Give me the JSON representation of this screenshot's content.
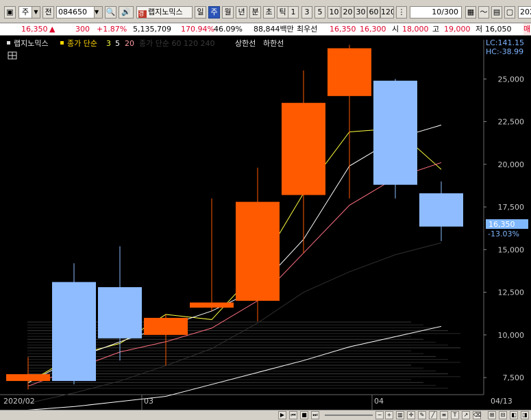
{
  "toolbar": {
    "market_select": "주",
    "prev_label": "전",
    "stock_code": "084650",
    "stock_name": "랩지노믹스",
    "period_tabs": [
      {
        "label": "일",
        "active": false
      },
      {
        "label": "주",
        "active": true
      },
      {
        "label": "월",
        "active": false
      },
      {
        "label": "년",
        "active": false
      },
      {
        "label": "분",
        "active": false
      },
      {
        "label": "초",
        "active": false
      },
      {
        "label": "틱",
        "active": false
      }
    ],
    "interval_buttons": [
      "1",
      "3",
      "5",
      "10",
      "20",
      "30",
      "60",
      "120"
    ],
    "count_value": "10",
    "count_total": "/300",
    "date_value": "202"
  },
  "quote": {
    "price": "16,350",
    "change_symbol": "▲",
    "change": "300",
    "change_pct": "+1.87%",
    "volume": "5,135,709",
    "volume_ratio": "170.94%",
    "turnover": "46.09%",
    "amount": "88,844백만",
    "ref_label": "최우선",
    "best_ask": "16,350",
    "best_bid": "16,300",
    "open_label": "시",
    "open": "18,000",
    "high_label": "고",
    "high": "19,000",
    "low_label": "저",
    "low": "16,050",
    "trailing": "매"
  },
  "legend": {
    "name": "랩지노믹스",
    "ma_label": "종가 단순",
    "ma_periods": [
      "3",
      "5",
      "20"
    ],
    "ma_periods_dim": "60 120 240",
    "upper_limit": "상한선",
    "lower_limit": "하한선"
  },
  "right_info": {
    "lc": "LC:141.15",
    "hc": "HC:-38.99",
    "current_price": "16,350",
    "current_pct": "-13.03%"
  },
  "chart_data": {
    "type": "candlestick",
    "x_tick_labels": [
      "2020/02",
      "03",
      "04",
      "04/13"
    ],
    "y_ticks": [
      7500,
      10000,
      12500,
      15000,
      17500,
      20000,
      22500,
      25000
    ],
    "y_tick_labels": [
      "7,500",
      "10,000",
      "12,500",
      "15,000",
      "17,500",
      "20,000",
      "22,500",
      "25,000"
    ],
    "ylim": [
      6500,
      27300
    ],
    "candles": [
      {
        "open": 7300,
        "high": 8700,
        "low": 6800,
        "close": 7700
      },
      {
        "open": 13100,
        "high": 14200,
        "low": 7100,
        "close": 7300
      },
      {
        "open": 12800,
        "high": 15200,
        "low": 8500,
        "close": 9800
      },
      {
        "open": 10000,
        "high": 11200,
        "low": 8200,
        "close": 11000
      },
      {
        "open": 11600,
        "high": 18000,
        "low": 11400,
        "close": 11900
      },
      {
        "open": 12000,
        "high": 19800,
        "low": 10800,
        "close": 17800
      },
      {
        "open": 18200,
        "high": 25500,
        "low": 14800,
        "close": 23600
      },
      {
        "open": 24000,
        "high": 27000,
        "low": 18000,
        "close": 26800
      },
      {
        "open": 24900,
        "high": 25000,
        "low": 18000,
        "close": 18800
      },
      {
        "open": 18300,
        "high": 19000,
        "low": 15500,
        "close": 16350
      }
    ],
    "series": [
      {
        "name": "3",
        "color": "#ffff40",
        "values": [
          7200,
          8800,
          9500,
          11200,
          10900,
          13800,
          18300,
          21900,
          22100,
          19700
        ]
      },
      {
        "name": "5",
        "color": "#ffffff",
        "values": [
          7200,
          8600,
          9600,
          10500,
          11400,
          12700,
          15600,
          19900,
          21500,
          22300
        ]
      },
      {
        "name": "20",
        "color": "#ff7080",
        "values": [
          7000,
          8000,
          9000,
          9600,
          10400,
          12000,
          14800,
          17600,
          19200,
          20100
        ]
      },
      {
        "name": "60",
        "color": "#303030",
        "values": [
          6000,
          6600,
          7300,
          8200,
          9200,
          10700,
          12500,
          13700,
          14700,
          15400
        ]
      },
      {
        "name": "120",
        "color": "#ffffff",
        "values": [
          5600,
          5800,
          6100,
          6400,
          7100,
          7800,
          8500,
          9300,
          9900,
          10500
        ]
      }
    ]
  }
}
